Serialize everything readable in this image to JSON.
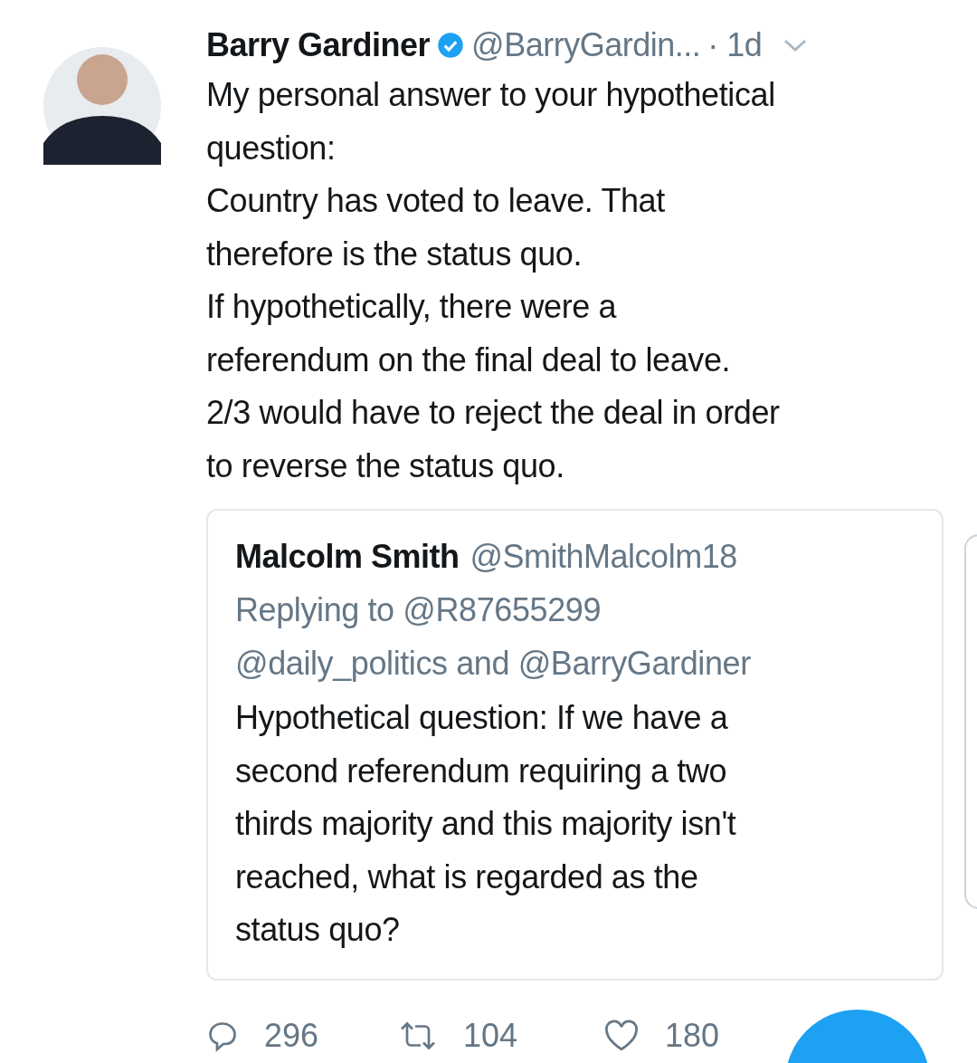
{
  "tweet": {
    "author": {
      "name": "Barry Gardiner",
      "verified": true,
      "handle": "@BarryGardin...",
      "time": "· 1d"
    },
    "text_lines": [
      "My personal answer to your hypothetical",
      "question:",
      "Country has voted to leave. That",
      "therefore is the status quo.",
      "If hypothetically, there were a",
      "referendum on the final deal to leave.",
      "2/3 would have to reject the deal in order",
      "to reverse the status quo."
    ],
    "quoted": {
      "name": "Malcolm Smith",
      "handle": "@SmithMalcolm18",
      "reply_lines": [
        "Replying to @R87655299",
        "@daily_politics and @BarryGardiner"
      ],
      "text_lines": [
        "Hypothetical question: If we have a",
        "second referendum requiring a two",
        "thirds majority and this majority isn't",
        "reached, what is regarded as the",
        "status quo?"
      ]
    },
    "actions": [
      {
        "kind": "reply",
        "count": "296"
      },
      {
        "kind": "retweet",
        "count": "104"
      },
      {
        "kind": "like",
        "count": "180"
      }
    ]
  }
}
